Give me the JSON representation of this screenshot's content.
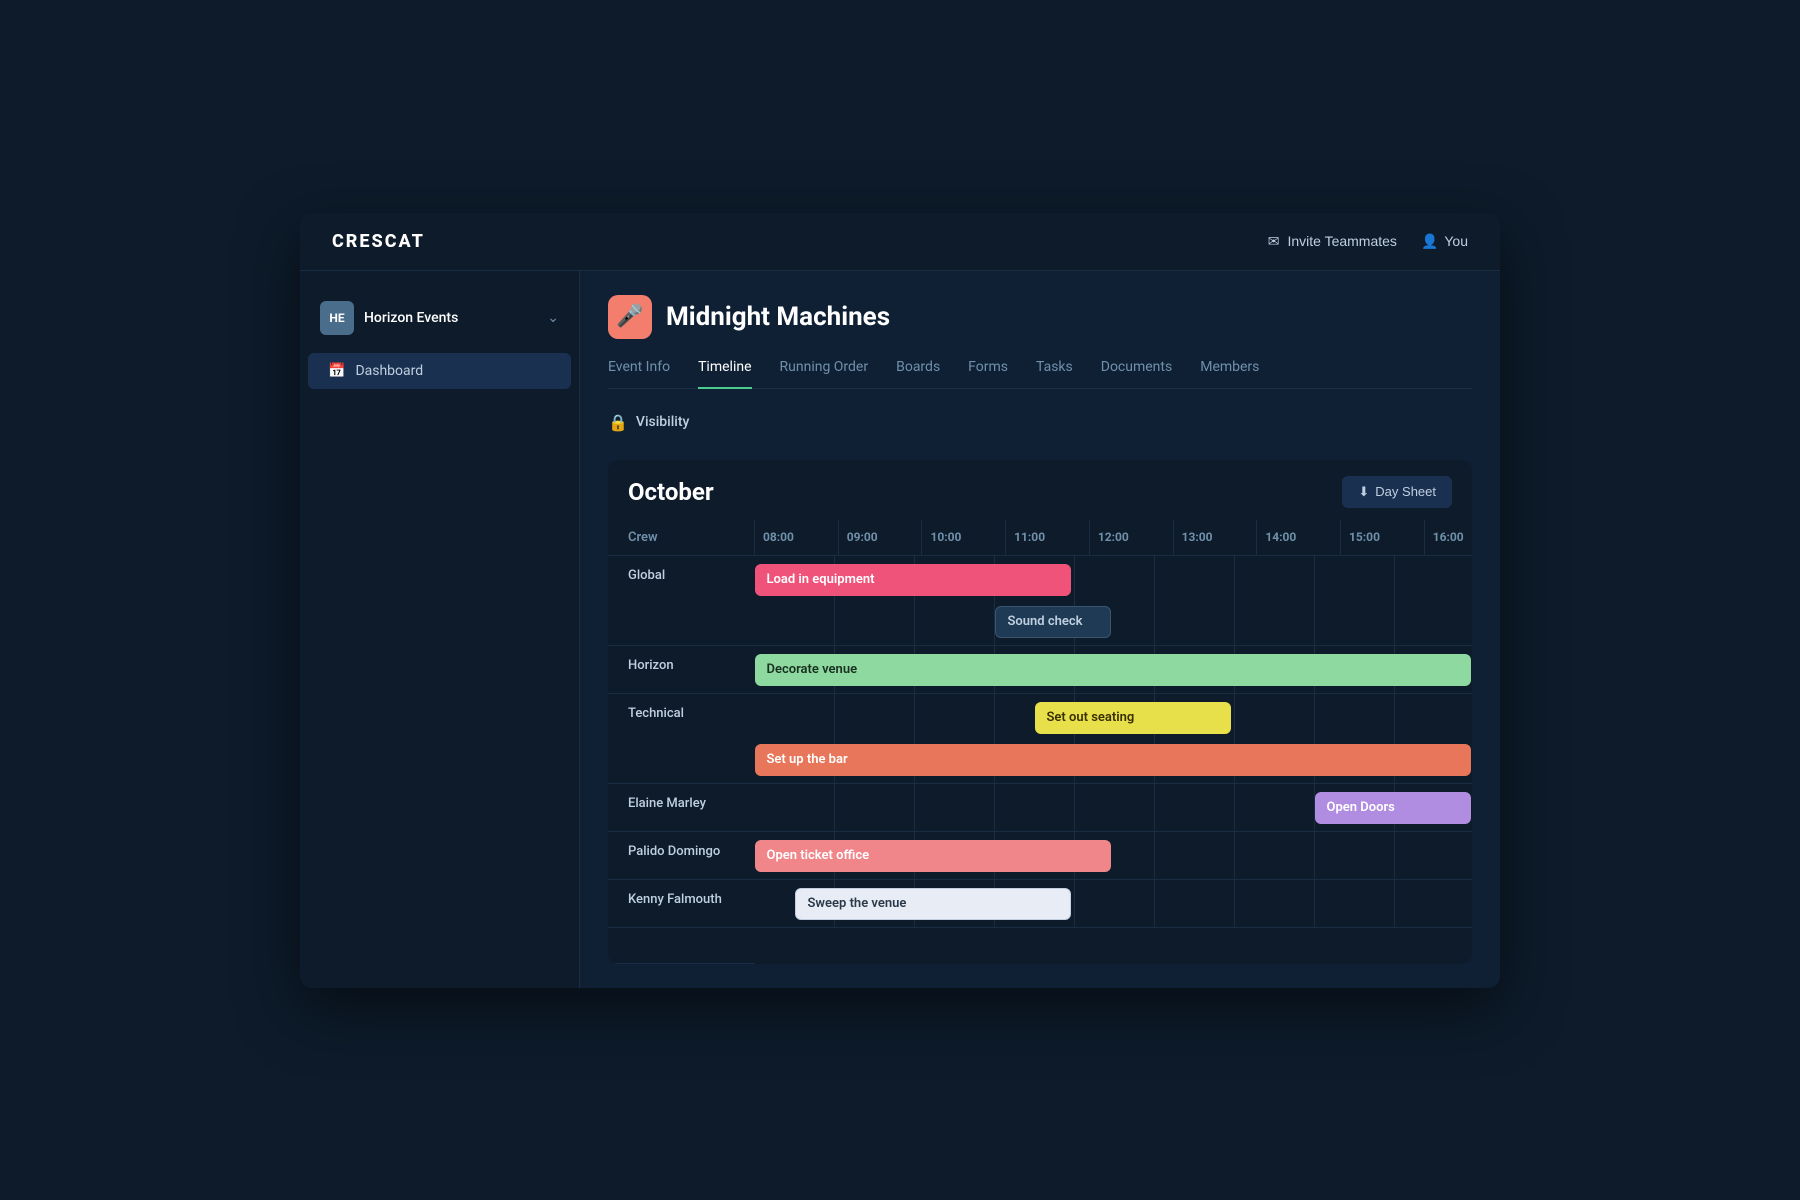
{
  "header": {
    "logo": "CRESCAT",
    "invite_label": "Invite Teammates",
    "user_label": "You"
  },
  "sidebar": {
    "org": {
      "initials": "HE",
      "name": "Horizon Events"
    },
    "items": [
      {
        "label": "Dashboard",
        "icon": "📅"
      }
    ]
  },
  "event": {
    "icon": "🎤",
    "title": "Midnight Machines",
    "tabs": [
      {
        "label": "Event Info",
        "active": false
      },
      {
        "label": "Timeline",
        "active": true
      },
      {
        "label": "Running Order",
        "active": false
      },
      {
        "label": "Boards",
        "active": false
      },
      {
        "label": "Forms",
        "active": false
      },
      {
        "label": "Tasks",
        "active": false
      },
      {
        "label": "Documents",
        "active": false
      },
      {
        "label": "Members",
        "active": false
      }
    ],
    "visibility_label": "Visibility"
  },
  "timeline": {
    "month": "October",
    "day_sheet_btn": "Day Sheet",
    "time_labels": [
      "08:00",
      "09:00",
      "10:00",
      "11:00",
      "12:00",
      "13:00",
      "14:00",
      "15:00",
      "16:00"
    ],
    "crew_header": "Crew",
    "rows": [
      {
        "label": "Global",
        "bars": [
          {
            "label": "Load in equipment",
            "color": "pink",
            "start": 0,
            "span": 4.0
          },
          {
            "label": "Sound check",
            "color": "dark-outline",
            "start": 3.0,
            "span": 1.5
          }
        ]
      },
      {
        "label": "Horizon",
        "bars": [
          {
            "label": "Decorate venue",
            "color": "green",
            "start": 0,
            "span": 9.0
          }
        ]
      },
      {
        "label": "Technical",
        "bars": [
          {
            "label": "Set out seating",
            "color": "yellow",
            "start": 3.5,
            "span": 2.5
          },
          {
            "label": "Set up the bar",
            "color": "salmon",
            "start": 0,
            "span": 9.0
          }
        ]
      },
      {
        "label": "Elaine Marley",
        "bars": [
          {
            "label": "Open Doors",
            "color": "purple",
            "start": 7.0,
            "span": 2.0
          }
        ]
      },
      {
        "label": "Palido Domingo",
        "bars": [
          {
            "label": "Open ticket office",
            "color": "pink-light",
            "start": 0,
            "span": 4.5
          }
        ]
      },
      {
        "label": "Kenny Falmouth",
        "bars": [
          {
            "label": "Sweep the venue",
            "color": "light-outline",
            "start": 0.5,
            "span": 3.5
          }
        ]
      }
    ]
  }
}
